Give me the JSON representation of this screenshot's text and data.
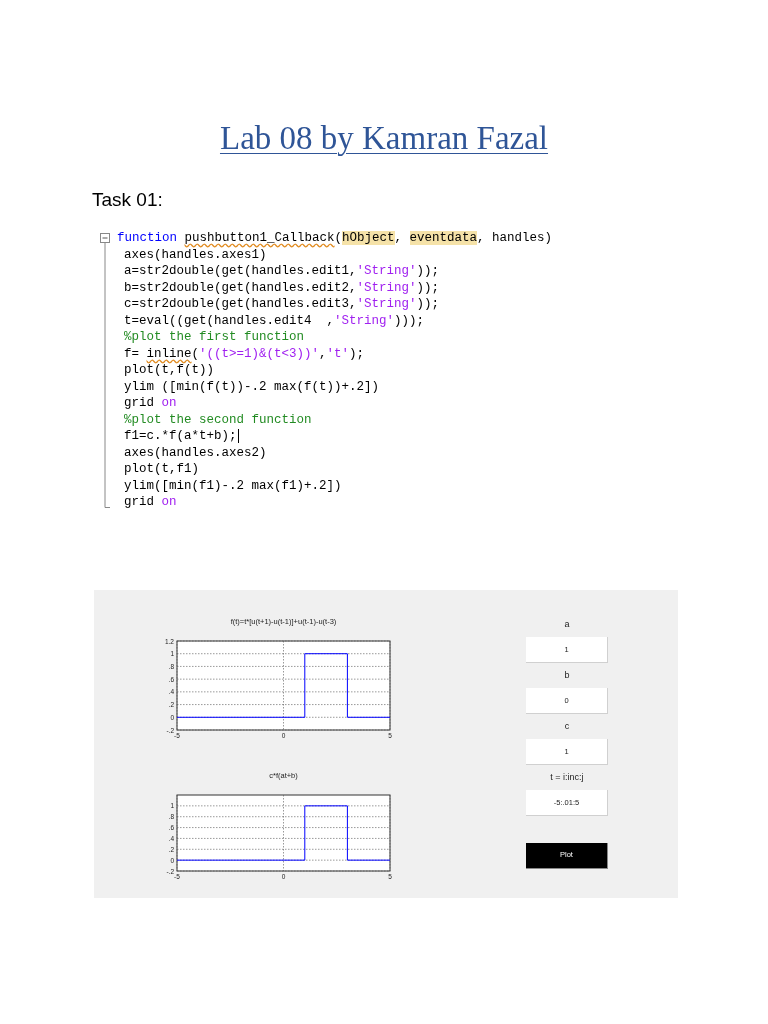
{
  "title": "Lab 08 by Kamran Fazal",
  "task_heading": "Task 01:",
  "code": {
    "lines": [
      {
        "segments": [
          {
            "kind": "keyword",
            "text": "function "
          },
          {
            "kind": "flagged",
            "text": "pushbutton1_Callback"
          },
          {
            "kind": "plain",
            "text": "("
          },
          {
            "kind": "highlighted",
            "text": "hObject"
          },
          {
            "kind": "plain",
            "text": ", "
          },
          {
            "kind": "highlighted",
            "text": "eventdata"
          },
          {
            "kind": "plain",
            "text": ", handles)"
          }
        ]
      },
      {
        "segments": [
          {
            "kind": "plain",
            "text": "axes(handles.axes1)"
          }
        ]
      },
      {
        "segments": [
          {
            "kind": "plain",
            "text": "a=str2double(get(handles.edit1,"
          },
          {
            "kind": "string",
            "text": "'String'"
          },
          {
            "kind": "plain",
            "text": "));"
          }
        ]
      },
      {
        "segments": [
          {
            "kind": "plain",
            "text": "b=str2double(get(handles.edit2,"
          },
          {
            "kind": "string",
            "text": "'String'"
          },
          {
            "kind": "plain",
            "text": "));"
          }
        ]
      },
      {
        "segments": [
          {
            "kind": "plain",
            "text": "c=str2double(get(handles.edit3,"
          },
          {
            "kind": "string",
            "text": "'String'"
          },
          {
            "kind": "plain",
            "text": "));"
          }
        ]
      },
      {
        "segments": [
          {
            "kind": "plain",
            "text": "t=eval((get(handles.edit4  ,"
          },
          {
            "kind": "string",
            "text": "'String'"
          },
          {
            "kind": "plain",
            "text": ")));"
          }
        ]
      },
      {
        "segments": [
          {
            "kind": "comment",
            "text": "%plot the first function"
          }
        ]
      },
      {
        "segments": [
          {
            "kind": "plain",
            "text": "f= "
          },
          {
            "kind": "flagged",
            "text": "inline"
          },
          {
            "kind": "plain",
            "text": "("
          },
          {
            "kind": "string",
            "text": "'((t>=1)&(t<3))'"
          },
          {
            "kind": "plain",
            "text": ","
          },
          {
            "kind": "string",
            "text": "'t'"
          },
          {
            "kind": "plain",
            "text": ");"
          }
        ]
      },
      {
        "segments": [
          {
            "kind": "plain",
            "text": "plot(t,f(t))"
          }
        ]
      },
      {
        "segments": [
          {
            "kind": "plain",
            "text": "ylim ([min(f(t))-.2 max(f(t))+.2])"
          }
        ]
      },
      {
        "segments": [
          {
            "kind": "plain",
            "text": "grid "
          },
          {
            "kind": "string",
            "text": "on"
          }
        ]
      },
      {
        "segments": [
          {
            "kind": "comment",
            "text": "%plot the second function"
          }
        ]
      },
      {
        "segments": [
          {
            "kind": "plain",
            "text": "f1=c.*f(a*t+b);"
          }
        ],
        "cursor": true
      },
      {
        "segments": [
          {
            "kind": "plain",
            "text": "axes(handles.axes2)"
          }
        ]
      },
      {
        "segments": [
          {
            "kind": "plain",
            "text": "plot(t,f1)"
          }
        ]
      },
      {
        "segments": [
          {
            "kind": "plain",
            "text": "ylim([min(f1)-.2 max(f1)+.2])"
          }
        ]
      },
      {
        "segments": [
          {
            "kind": "plain",
            "text": "grid "
          },
          {
            "kind": "string",
            "text": "on"
          }
        ]
      }
    ]
  },
  "figure": {
    "plots": [
      {
        "chart_data": {
          "type": "line",
          "title": "f(t)=t*[u(t+1)-u(t-1)]+u(t-1)-u(t-3)",
          "x": [
            -5,
            1,
            1,
            3,
            3,
            5
          ],
          "series": [
            {
              "color": "#0000ff",
              "values": [
                0,
                0,
                1,
                1,
                0,
                0
              ]
            }
          ],
          "xlim": [
            -5,
            5
          ],
          "ylim": [
            -0.2,
            1.2
          ],
          "xticks": [
            -5,
            0,
            5
          ],
          "yticks": [
            {
              "value": -0.2,
              "label": "-.2"
            },
            0,
            {
              "value": 0.2,
              "label": ".2"
            },
            {
              "value": 0.4,
              "label": ".4"
            },
            {
              "value": 0.6,
              "label": ".6"
            },
            {
              "value": 0.8,
              "label": ".8"
            },
            1,
            1.2
          ],
          "grid": true
        }
      },
      {
        "chart_data": {
          "type": "line",
          "title": "c*f(at+b)",
          "x": [
            -5,
            1,
            1,
            3,
            3,
            5
          ],
          "series": [
            {
              "color": "#0000ff",
              "values": [
                0,
                0,
                1,
                1,
                0,
                0
              ]
            }
          ],
          "xlim": [
            -5,
            5
          ],
          "ylim": [
            -0.2,
            1.2
          ],
          "xticks": [
            -5,
            0,
            5
          ],
          "yticks": [
            {
              "value": -0.2,
              "label": "-.2"
            },
            0,
            {
              "value": 0.2,
              "label": ".2"
            },
            {
              "value": 0.4,
              "label": ".4"
            },
            {
              "value": 0.6,
              "label": ".6"
            },
            {
              "value": 0.8,
              "label": ".8"
            },
            1
          ],
          "grid": true
        }
      }
    ],
    "inputs": [
      {
        "label": "a",
        "value": "1"
      },
      {
        "label": "b",
        "value": "0"
      },
      {
        "label": "c",
        "value": "1"
      },
      {
        "label": "t = i:inc:j",
        "value": "-5:.01:5"
      }
    ],
    "button": "Plot"
  }
}
